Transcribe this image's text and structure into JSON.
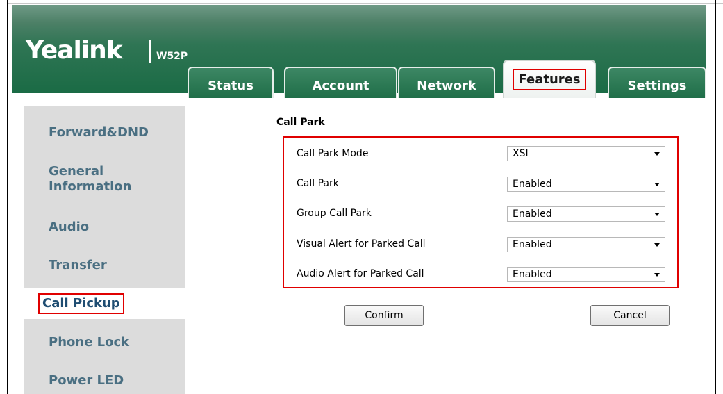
{
  "header": {
    "logo_text": "Yealink",
    "model": "W52P",
    "tabs": [
      {
        "label": "Status",
        "active": false
      },
      {
        "label": "Account",
        "active": false
      },
      {
        "label": "Network",
        "active": false
      },
      {
        "label": "Features",
        "active": true
      },
      {
        "label": "Settings",
        "active": false
      }
    ]
  },
  "sidebar": {
    "items": [
      {
        "label": "Forward&DND",
        "selected": false
      },
      {
        "label": "General Information",
        "selected": false
      },
      {
        "label": "Audio",
        "selected": false
      },
      {
        "label": "Transfer",
        "selected": false
      },
      {
        "label": "Call Pickup",
        "selected": true
      },
      {
        "label": "Phone Lock",
        "selected": false
      },
      {
        "label": "Power LED",
        "selected": false
      }
    ]
  },
  "main": {
    "section_title": "Call Park",
    "rows": [
      {
        "label": "Call Park Mode",
        "value": "XSI"
      },
      {
        "label": "Call Park",
        "value": "Enabled"
      },
      {
        "label": "Group Call Park",
        "value": "Enabled"
      },
      {
        "label": "Visual Alert for Parked Call",
        "value": "Enabled"
      },
      {
        "label": "Audio Alert for Parked Call",
        "value": "Enabled"
      }
    ],
    "confirm_label": "Confirm",
    "cancel_label": "Cancel"
  },
  "colors": {
    "header_green": "#1a6b45",
    "highlight_red": "#e00000",
    "sidebar_text": "#4a6f82",
    "sidebar_bg": "#dcdcdc"
  }
}
